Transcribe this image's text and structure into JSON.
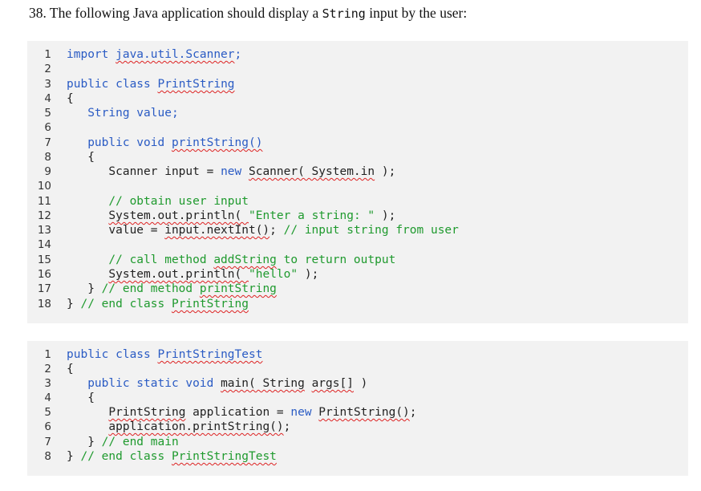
{
  "question": {
    "prefix": "38.  The following Java application should display a ",
    "code_word": "String",
    "suffix": " input by the user:"
  },
  "listing1": {
    "line_numbers": [
      "1",
      "2",
      "3",
      "4",
      "5",
      "6",
      "7",
      "8",
      "9",
      "10",
      "11",
      "12",
      "13",
      "14",
      "15",
      "16",
      "17",
      "18"
    ],
    "l1": {
      "a": "import ",
      "b": "java.util.Scanner",
      "c": ";"
    },
    "l3": {
      "a": "public class ",
      "b": "PrintString"
    },
    "l4": {
      "a": "{"
    },
    "l5": {
      "a": "   String value;"
    },
    "l7": {
      "a": "   public void ",
      "b": "printString()"
    },
    "l8": {
      "a": "   {"
    },
    "l9": {
      "a": "      Scanner input = ",
      "b": "new ",
      "c": "Scanner( System.in",
      "d": " );"
    },
    "l11": {
      "a": "      // obtain user input"
    },
    "l12": {
      "a": "      ",
      "b": "System.out.println( ",
      "c": "\"Enter a string: \"",
      "d": " );"
    },
    "l13": {
      "a": "      value = ",
      "b": "input.nextInt()",
      "c": "; ",
      "d": "// input string from user"
    },
    "l15": {
      "a": "      // call method ",
      "b": "addString",
      "c": " to return output"
    },
    "l16": {
      "a": "      ",
      "b": "System.out.println( ",
      "c": "\"hello\"",
      "d": " );"
    },
    "l17": {
      "a": "   } ",
      "b": "// end method ",
      "c": "printString"
    },
    "l18": {
      "a": "} ",
      "b": "// end class ",
      "c": "PrintString"
    }
  },
  "listing2": {
    "line_numbers": [
      "1",
      "2",
      "3",
      "4",
      "5",
      "6",
      "7",
      "8"
    ],
    "l1": {
      "a": "public class ",
      "b": "PrintStringTest"
    },
    "l2": {
      "a": "{"
    },
    "l3": {
      "a": "   public static void ",
      "b": "main( String",
      "c": " ",
      "d": "args[]",
      "e": " )"
    },
    "l4": {
      "a": "   {"
    },
    "l5": {
      "a": "      ",
      "b": "PrintString",
      "c": " application = ",
      "d": "new ",
      "e": "PrintString()",
      "f": ";"
    },
    "l6": {
      "a": "      ",
      "b": "application.printString()",
      "c": ";"
    },
    "l7": {
      "a": "   } ",
      "b": "// end main"
    },
    "l8": {
      "a": "} ",
      "b": "// end class ",
      "c": "PrintStringTest"
    }
  },
  "colors": {
    "keyword": "#2a5bc4",
    "comment": "#1f9a2e",
    "panel_background": "#f2f2f2",
    "squiggle": "#d22"
  }
}
